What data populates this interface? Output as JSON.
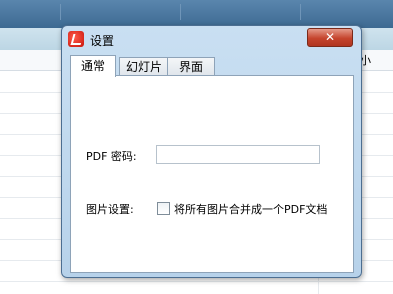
{
  "background": {
    "column_header_fragment": "小"
  },
  "dialog": {
    "title": "设置",
    "close_glyph": "✕",
    "tabs": [
      {
        "label": "通常",
        "active": true
      },
      {
        "label": "幻灯片",
        "active": false
      },
      {
        "label": "界面",
        "active": false
      }
    ],
    "pdf_password": {
      "label": "PDF 密码:",
      "value": ""
    },
    "image_settings": {
      "label": "图片设置:",
      "checkbox_label": "将所有图片合并成一个PDF文档",
      "checked": false
    }
  }
}
